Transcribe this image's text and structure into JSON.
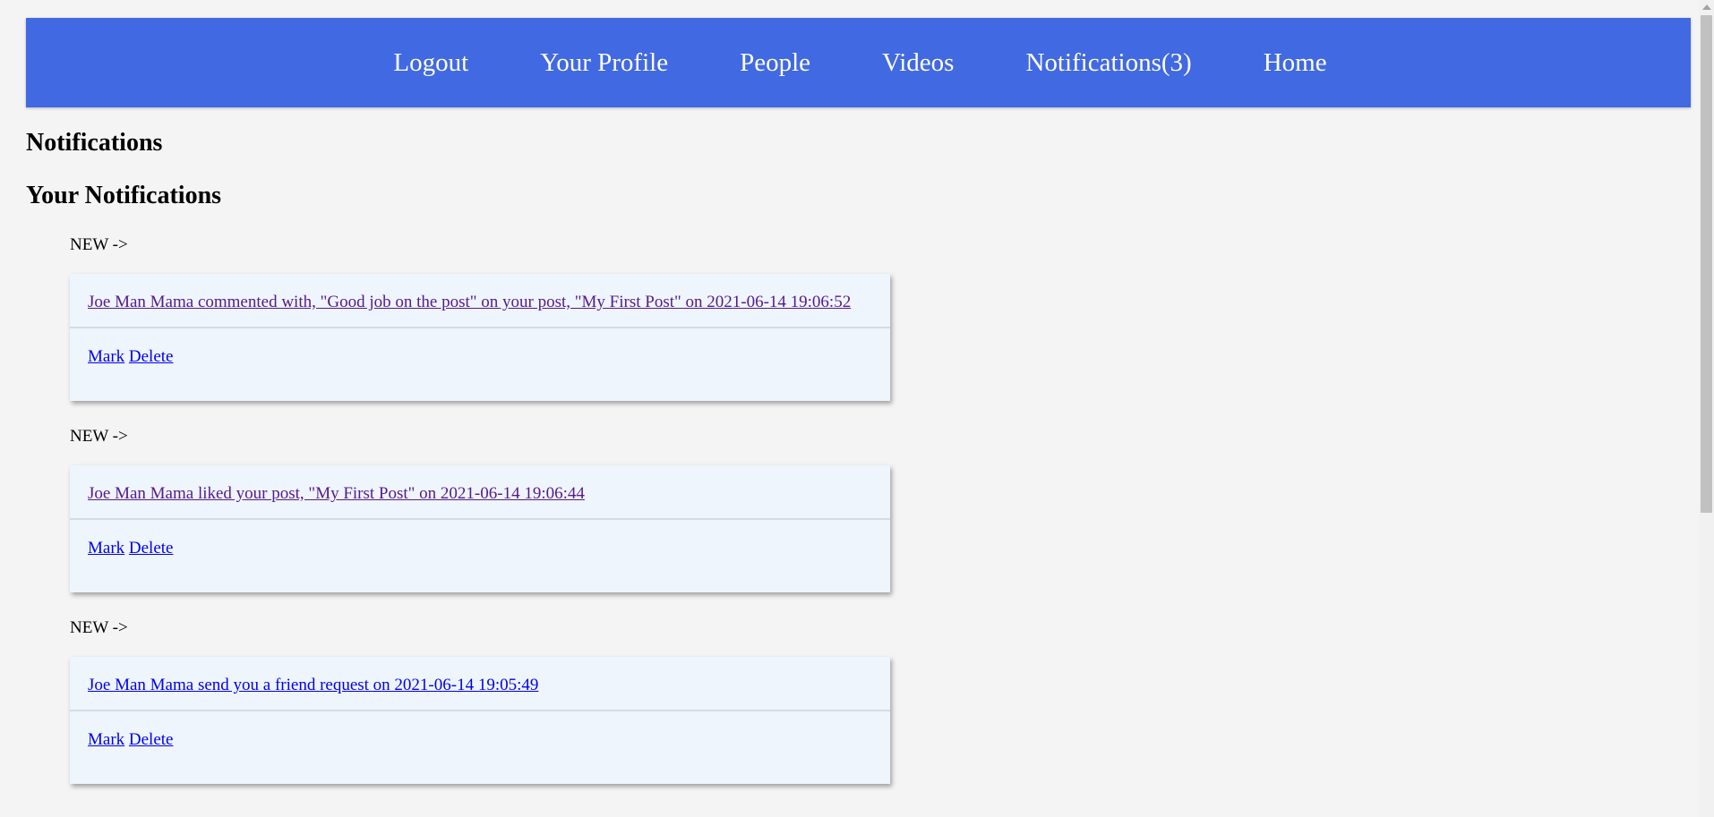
{
  "nav": {
    "items": [
      {
        "label": "Logout"
      },
      {
        "label": "Your Profile"
      },
      {
        "label": "People"
      },
      {
        "label": "Videos"
      },
      {
        "label": "Notifications(3)"
      },
      {
        "label": "Home"
      }
    ]
  },
  "page_title": "Notifications",
  "section_title": "Your Notifications",
  "notifications": [
    {
      "status": "NEW ->",
      "text": "Joe Man Mama commented with, \"Good job on the post\" on your post, \"My First Post\" on 2021-06-14 19:06:52",
      "mark_label": "Mark",
      "delete_label": "Delete"
    },
    {
      "status": "NEW ->",
      "text": "Joe Man Mama liked your post, \"My First Post\" on 2021-06-14 19:06:44",
      "mark_label": "Mark",
      "delete_label": "Delete"
    },
    {
      "status": "NEW ->",
      "text": "Joe Man Mama send you a friend request on 2021-06-14 19:05:49",
      "mark_label": "Mark",
      "delete_label": "Delete"
    }
  ],
  "colors": {
    "navbar": "#4169e1",
    "background": "#f4f4f4",
    "card": "#eef5fc",
    "link": "#0000ee",
    "visited_link": "#551a8b"
  }
}
